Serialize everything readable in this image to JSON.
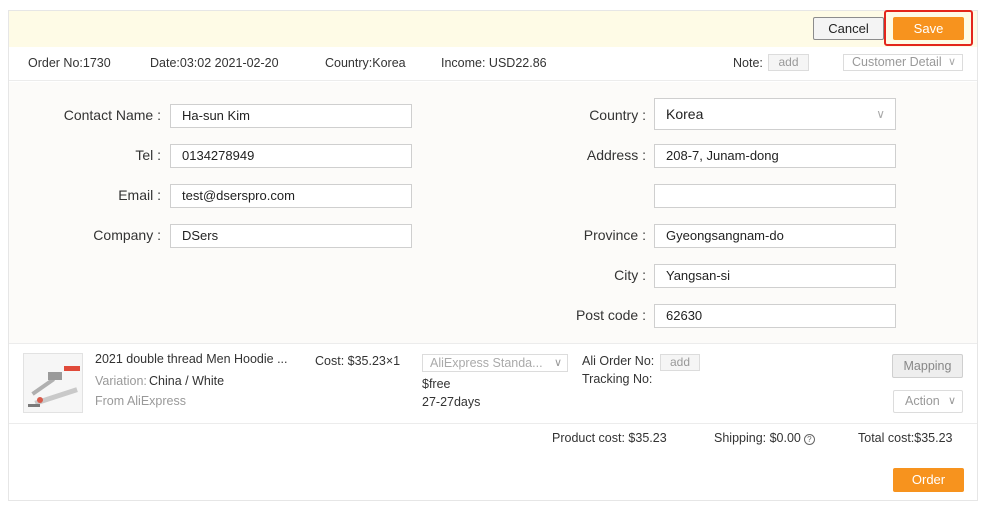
{
  "actions": {
    "cancel_label": "Cancel",
    "save_label": "Save"
  },
  "order_info": {
    "order_no": "Order No:1730",
    "date": "Date:03:02 2021-02-20",
    "country": "Country:Korea",
    "income": "Income: USD22.86",
    "note_label": "Note:",
    "note_add": "add",
    "customer_detail": "Customer Detail"
  },
  "address": {
    "contact_name_label": "Contact Name :",
    "contact_name": "Ha-sun Kim",
    "tel_label": "Tel :",
    "tel": "0134278949",
    "email_label": "Email :",
    "email": "test@dserspro.com",
    "company_label": "Company :",
    "company": "DSers",
    "country_label": "Country :",
    "country": "Korea",
    "address_label": "Address :",
    "address1": "208-7, Junam-dong",
    "address2": "",
    "province_label": "Province :",
    "province": "Gyeongsangnam-do",
    "city_label": "City :",
    "city": "Yangsan-si",
    "postcode_label": "Post code :",
    "postcode": "62630"
  },
  "product": {
    "title": "2021 double thread Men Hoodie ...",
    "variation_label": "Variation:",
    "variation": "China / White",
    "source": "From AliExpress",
    "cost": "Cost: $35.23×1",
    "shipping_method": "AliExpress Standa...",
    "shipping_price": "$free",
    "shipping_days": "27-27days",
    "ali_order_label": "Ali Order No:",
    "ali_order_add": "add",
    "tracking_label": "Tracking No:",
    "mapping_label": "Mapping",
    "action_label": "Action"
  },
  "totals": {
    "product_cost": "Product cost: $35.23",
    "shipping": "Shipping: $0.00",
    "total_cost": "Total cost:$35.23",
    "order_label": "Order"
  },
  "icons": {
    "chevron": "chevron-down-icon",
    "help": "question-circle-icon"
  },
  "colors": {
    "accent": "#f7931e",
    "highlight": "#e3261b",
    "topbar_bg": "#fefbe6"
  }
}
